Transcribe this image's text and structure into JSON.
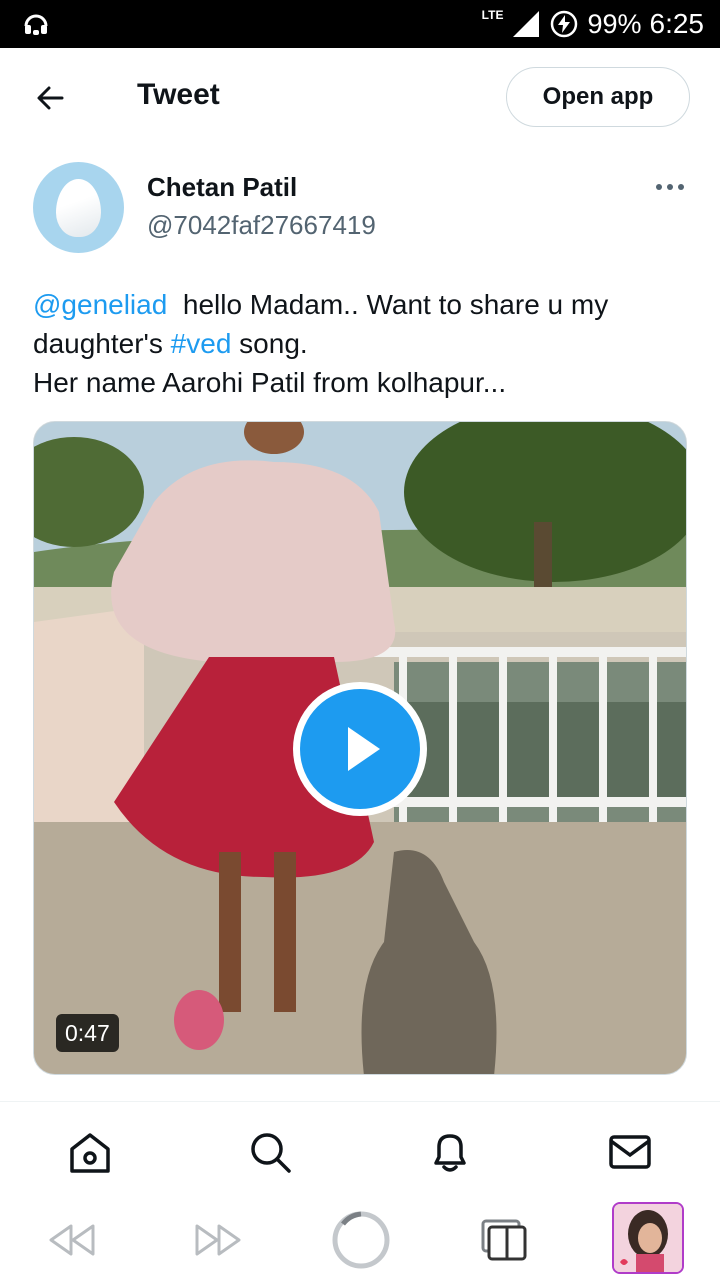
{
  "status_bar": {
    "network": "LTE",
    "battery": "99%",
    "time": "6:25"
  },
  "header": {
    "title": "Tweet",
    "open_app_label": "Open app"
  },
  "tweet": {
    "author_name": "Chetan Patil",
    "author_handle": "@7042faf27667419",
    "mention": "@geneliad",
    "text_part1": "  hello Madam.. Want to share u my daughter's ",
    "hashtag": "#ved",
    "text_part2": " song.",
    "text_line3": "Her name Aarohi Patil from kolhapur...",
    "video_duration": "0:47"
  },
  "bottom_nav": {
    "items": [
      "home-icon",
      "search-icon",
      "notifications-icon",
      "messages-icon"
    ]
  },
  "browser_toolbar": {
    "items": [
      "back-icon",
      "forward-icon",
      "home-circle-icon",
      "tabs-icon",
      "profile-thumbnail"
    ]
  },
  "colors": {
    "accent": "#1d9bf0",
    "text_primary": "#0f1419",
    "text_secondary": "#536471",
    "border": "#cfd9de",
    "profile_border": "#b03cc9"
  }
}
